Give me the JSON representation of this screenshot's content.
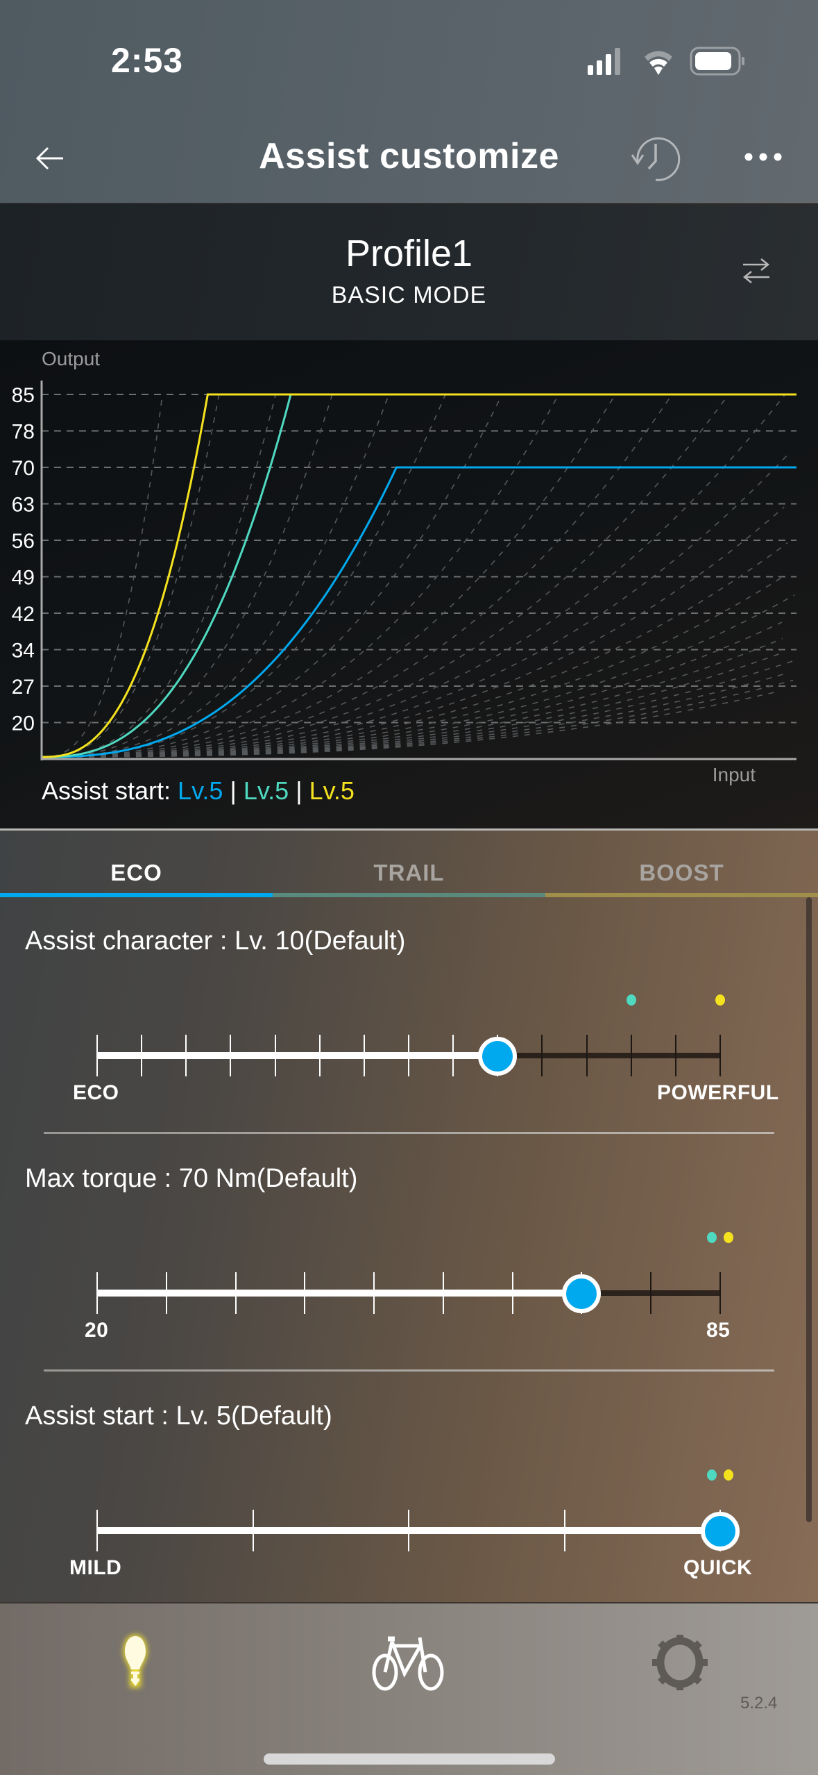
{
  "status_bar": {
    "time": "2:53"
  },
  "nav": {
    "title": "Assist customize",
    "back_icon": "arrow-left-icon",
    "history_icon": "history-icon",
    "more_icon": "more-horizontal-icon"
  },
  "profile": {
    "name": "Profile1",
    "mode": "BASIC MODE",
    "switch_icon": "swap-arrows-icon"
  },
  "colors": {
    "eco": "#00a8ee",
    "trail": "#4fd9c1",
    "boost": "#f5e21e"
  },
  "chart_data": {
    "type": "line",
    "ylabel": "Output",
    "xlabel": "Input",
    "y_ticks": [
      "85",
      "78",
      "70",
      "63",
      "56",
      "49",
      "42",
      "34",
      "27",
      "20"
    ],
    "grid": true,
    "series": [
      {
        "name": "BOOST",
        "color": "#f5e21e",
        "max_output": 85,
        "reach_input_fraction": 0.22
      },
      {
        "name": "TRAIL",
        "color": "#4fd9c1",
        "max_output": 85,
        "reach_input_fraction": 0.33
      },
      {
        "name": "ECO",
        "color": "#00a8ee",
        "max_output": 70,
        "reach_input_fraction": 0.47
      }
    ],
    "footer": {
      "label": "Assist start:",
      "values": [
        "Lv.5",
        "Lv.5",
        "Lv.5"
      ],
      "separator": "|"
    }
  },
  "tabs": [
    {
      "label": "ECO",
      "active": true,
      "color": "#00a8ee"
    },
    {
      "label": "TRAIL",
      "active": false,
      "color": "#5a8a7e"
    },
    {
      "label": "BOOST",
      "active": false,
      "color": "#a08f4a"
    }
  ],
  "settings": [
    {
      "title": "Assist character : Lv. 10(Default)",
      "steps": 15,
      "value_index": 10,
      "min_label": "ECO",
      "max_label": "POWERFUL",
      "markers": [
        {
          "mode": "TRAIL",
          "index": 13
        },
        {
          "mode": "BOOST",
          "index": 15
        }
      ]
    },
    {
      "title": "Max torque : 70 Nm(Default)",
      "steps": 10,
      "value_index": 8,
      "value": 70,
      "min_label": "20",
      "max_label": "85",
      "markers": [
        {
          "mode": "TRAIL",
          "index": 10
        },
        {
          "mode": "BOOST",
          "index": 10
        }
      ]
    },
    {
      "title": "Assist start : Lv. 5(Default)",
      "steps": 5,
      "value_index": 5,
      "min_label": "MILD",
      "max_label": "QUICK",
      "markers": [
        {
          "mode": "TRAIL",
          "index": 5
        },
        {
          "mode": "BOOST",
          "index": 5
        }
      ]
    }
  ],
  "bottom_nav": {
    "items": [
      {
        "icon": "lightbulb-icon",
        "active": true
      },
      {
        "icon": "bicycle-icon",
        "active": false
      },
      {
        "icon": "gear-icon",
        "active": false
      }
    ],
    "version": "5.2.4"
  }
}
